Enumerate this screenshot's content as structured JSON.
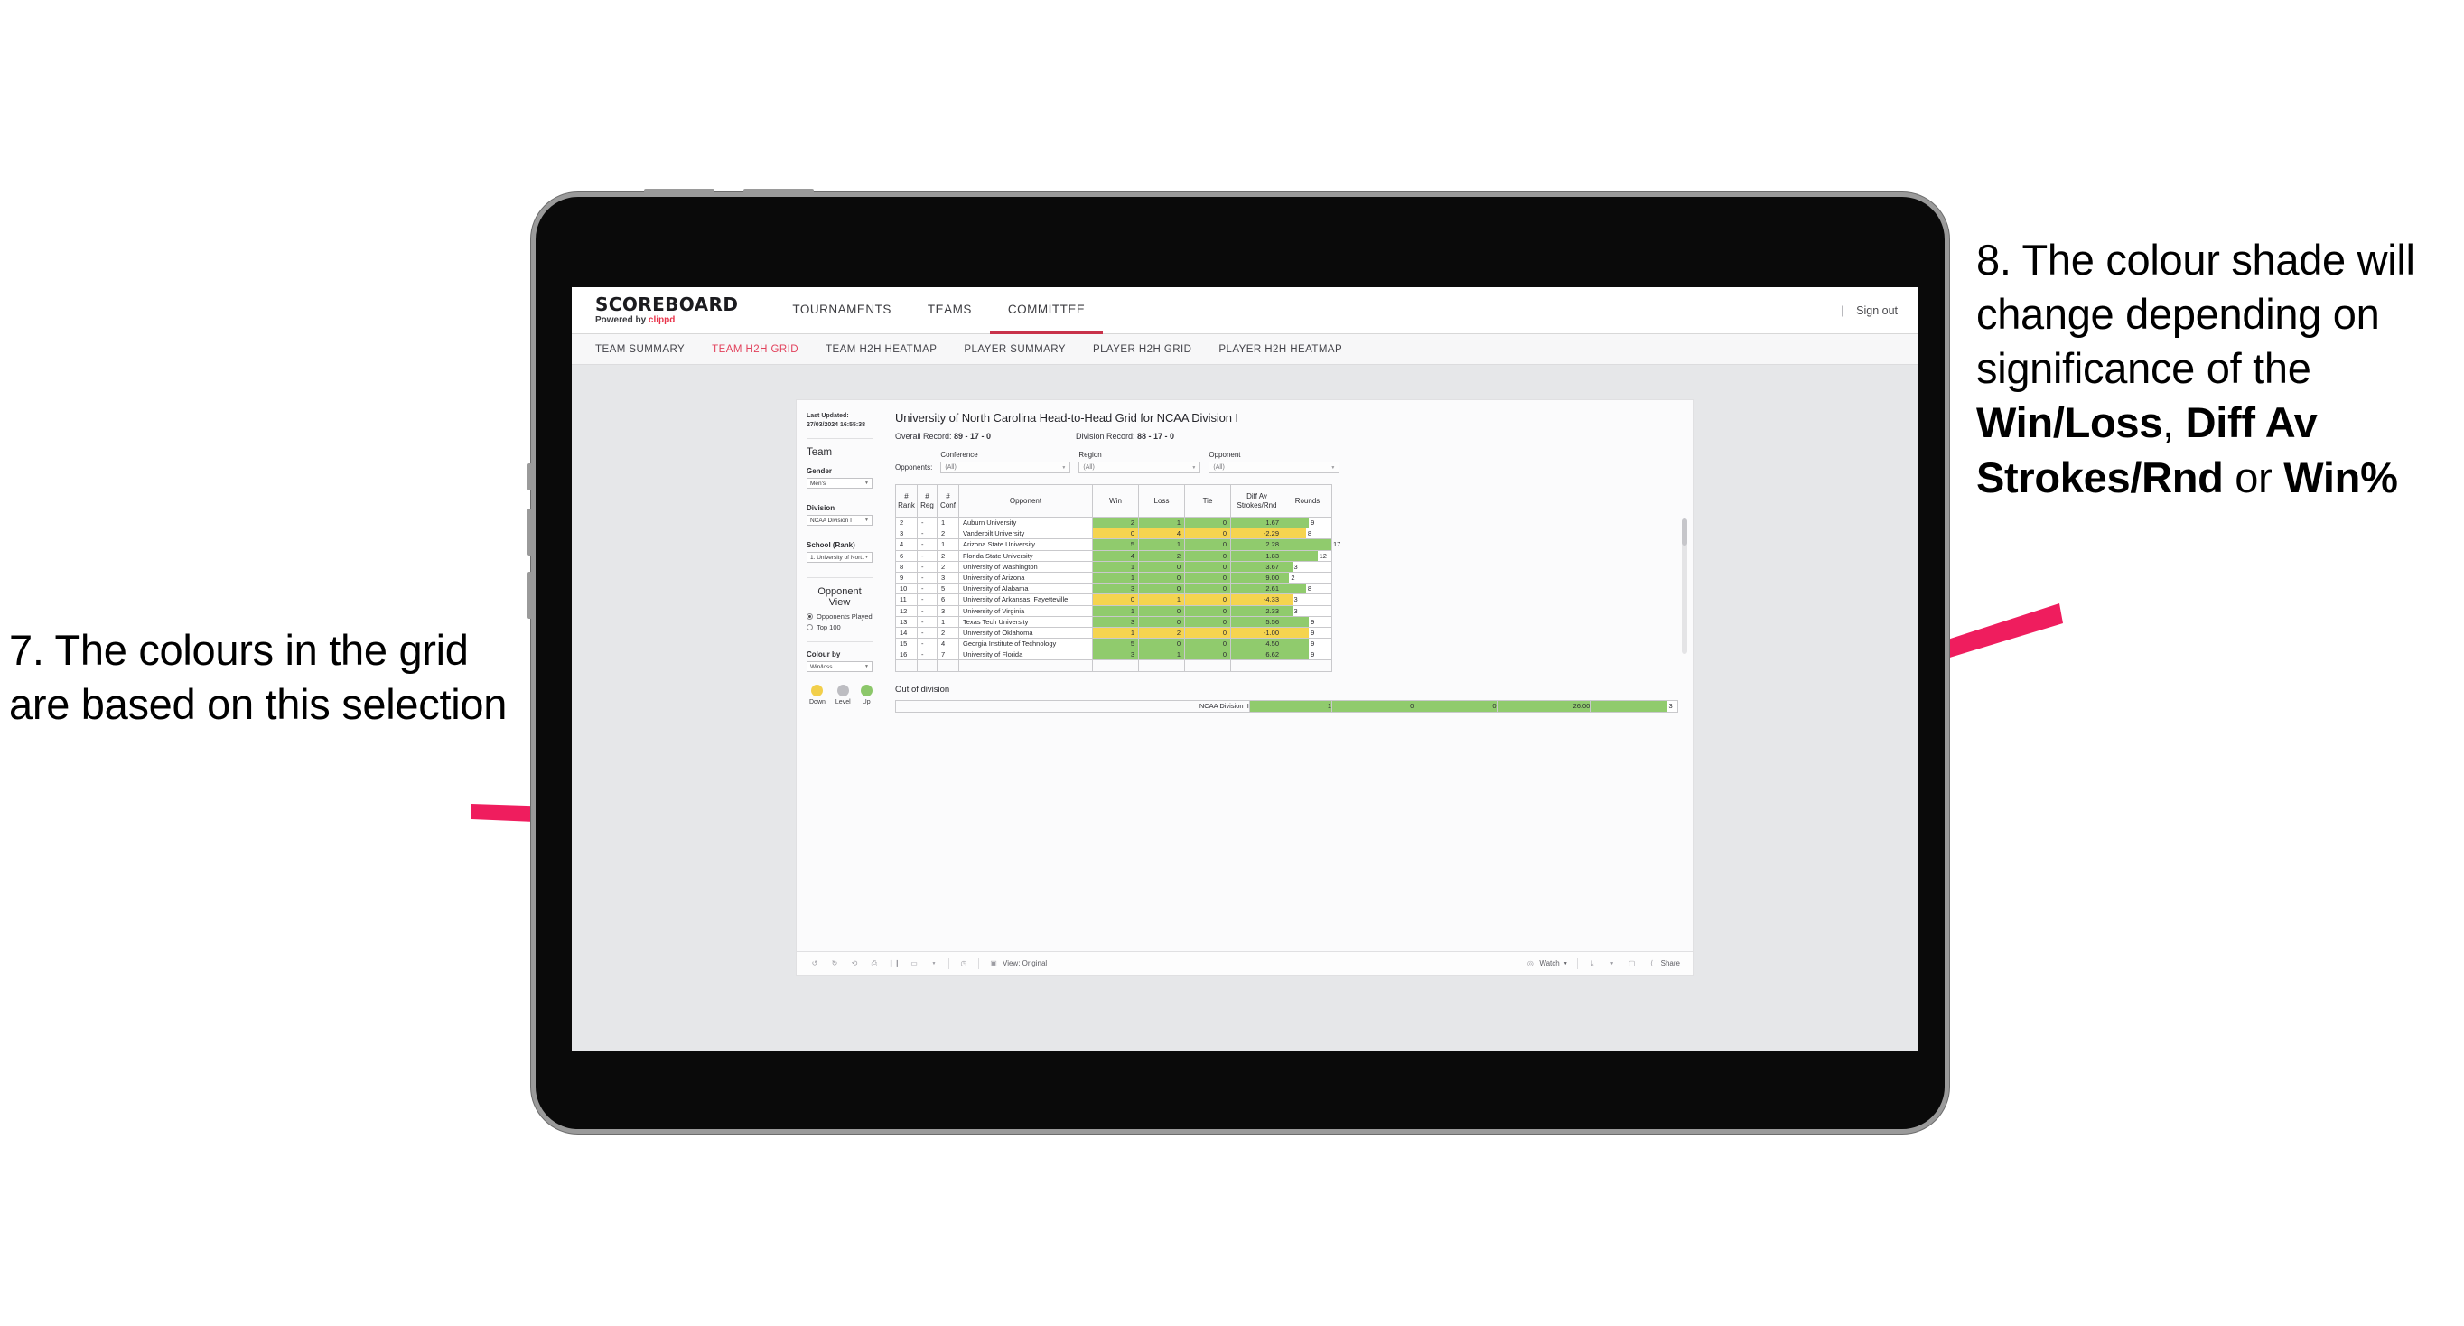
{
  "annotations": {
    "left": {
      "id": "7",
      "text": "7. The colours in the grid are based on this selection"
    },
    "right": {
      "id": "8",
      "prefix": "8. The colour shade will change depending on significance of the ",
      "bold1": "Win/Loss",
      "mid1": ", ",
      "bold2": "Diff Av Strokes/Rnd",
      "mid2": " or ",
      "bold3": "Win%"
    },
    "arrow_color": "#ef1d5e"
  },
  "app": {
    "logo": {
      "main": "SCOREBOARD",
      "sub_prefix": "Powered by ",
      "sub_brand": "clippd"
    },
    "nav": [
      {
        "label": "TOURNAMENTS",
        "active": false
      },
      {
        "label": "TEAMS",
        "active": false
      },
      {
        "label": "COMMITTEE",
        "active": true
      }
    ],
    "header_right": {
      "separator": "|",
      "signout": "Sign out"
    },
    "subtabs": [
      {
        "label": "TEAM SUMMARY",
        "active": false
      },
      {
        "label": "TEAM H2H GRID",
        "active": true
      },
      {
        "label": "TEAM H2H HEATMAP",
        "active": false
      },
      {
        "label": "PLAYER SUMMARY",
        "active": false
      },
      {
        "label": "PLAYER H2H GRID",
        "active": false
      },
      {
        "label": "PLAYER H2H HEATMAP",
        "active": false
      }
    ]
  },
  "sidebar": {
    "last_updated": "Last Updated: 27/03/2024 16:55:38",
    "team_title": "Team",
    "gender": {
      "label": "Gender",
      "value": "Men's"
    },
    "division": {
      "label": "Division",
      "value": "NCAA Division I"
    },
    "school": {
      "label": "School (Rank)",
      "value": "1. University of Nort..."
    },
    "opponent_view": {
      "title": "Opponent View",
      "options": [
        {
          "label": "Opponents Played",
          "selected": true
        },
        {
          "label": "Top 100",
          "selected": false
        }
      ]
    },
    "colour_by": {
      "label": "Colour by",
      "value": "Win/loss"
    },
    "legend": [
      {
        "label": "Down",
        "color": "#f2cf4b"
      },
      {
        "label": "Level",
        "color": "#bdbdc2"
      },
      {
        "label": "Up",
        "color": "#8cc76a"
      }
    ]
  },
  "main": {
    "title": "University of North Carolina Head-to-Head Grid for NCAA Division I",
    "overall_record_label": "Overall Record: ",
    "overall_record_value": "89 - 17 - 0",
    "division_record_label": "Division Record: ",
    "division_record_value": "88 - 17 - 0",
    "filters": {
      "lead": "Opponents:",
      "items": [
        {
          "label": "Conference",
          "value": "(All)"
        },
        {
          "label": "Region",
          "value": "(All)"
        },
        {
          "label": "Opponent",
          "value": "(All)"
        }
      ]
    },
    "table": {
      "headers": [
        "# Rank",
        "# Reg",
        "# Conf",
        "Opponent",
        "Win",
        "Loss",
        "Tie",
        "Diff Av Strokes/Rnd",
        "Rounds"
      ],
      "headers_split": [
        [
          "#",
          "Rank"
        ],
        [
          "#",
          "Reg"
        ],
        [
          "#",
          "Conf"
        ],
        [
          "",
          "Opponent"
        ],
        [
          "",
          "Win"
        ],
        [
          "",
          "Loss"
        ],
        [
          "",
          "Tie"
        ],
        [
          "Diff Av",
          "Strokes/Rnd"
        ],
        [
          "",
          "Rounds"
        ]
      ],
      "rows": [
        {
          "rank": "2",
          "reg": "-",
          "conf": "1",
          "opponent": "Auburn University",
          "win": "2",
          "loss": "1",
          "tie": "0",
          "diff": "1.67",
          "rounds": "9",
          "color": "green",
          "bar_pct": 53
        },
        {
          "rank": "3",
          "reg": "-",
          "conf": "2",
          "opponent": "Vanderbilt University",
          "win": "0",
          "loss": "4",
          "tie": "0",
          "diff": "-2.29",
          "rounds": "8",
          "color": "yellow",
          "bar_pct": 47
        },
        {
          "rank": "4",
          "reg": "-",
          "conf": "1",
          "opponent": "Arizona State University",
          "win": "5",
          "loss": "1",
          "tie": "0",
          "diff": "2.28",
          "rounds": "17",
          "color": "green",
          "bar_pct": 100
        },
        {
          "rank": "6",
          "reg": "-",
          "conf": "2",
          "opponent": "Florida State University",
          "win": "4",
          "loss": "2",
          "tie": "0",
          "diff": "1.83",
          "rounds": "12",
          "color": "green",
          "bar_pct": 71
        },
        {
          "rank": "8",
          "reg": "-",
          "conf": "2",
          "opponent": "University of Washington",
          "win": "1",
          "loss": "0",
          "tie": "0",
          "diff": "3.67",
          "rounds": "3",
          "color": "green",
          "bar_pct": 18
        },
        {
          "rank": "9",
          "reg": "-",
          "conf": "3",
          "opponent": "University of Arizona",
          "win": "1",
          "loss": "0",
          "tie": "0",
          "diff": "9.00",
          "rounds": "2",
          "color": "green",
          "bar_pct": 12
        },
        {
          "rank": "10",
          "reg": "-",
          "conf": "5",
          "opponent": "University of Alabama",
          "win": "3",
          "loss": "0",
          "tie": "0",
          "diff": "2.61",
          "rounds": "8",
          "color": "green",
          "bar_pct": 47
        },
        {
          "rank": "11",
          "reg": "-",
          "conf": "6",
          "opponent": "University of Arkansas, Fayetteville",
          "win": "0",
          "loss": "1",
          "tie": "0",
          "diff": "-4.33",
          "rounds": "3",
          "color": "yellow",
          "bar_pct": 18
        },
        {
          "rank": "12",
          "reg": "-",
          "conf": "3",
          "opponent": "University of Virginia",
          "win": "1",
          "loss": "0",
          "tie": "0",
          "diff": "2.33",
          "rounds": "3",
          "color": "green",
          "bar_pct": 18
        },
        {
          "rank": "13",
          "reg": "-",
          "conf": "1",
          "opponent": "Texas Tech University",
          "win": "3",
          "loss": "0",
          "tie": "0",
          "diff": "5.56",
          "rounds": "9",
          "color": "green",
          "bar_pct": 53
        },
        {
          "rank": "14",
          "reg": "-",
          "conf": "2",
          "opponent": "University of Oklahoma",
          "win": "1",
          "loss": "2",
          "tie": "0",
          "diff": "-1.00",
          "rounds": "9",
          "color": "yellow",
          "bar_pct": 53
        },
        {
          "rank": "15",
          "reg": "-",
          "conf": "4",
          "opponent": "Georgia Institute of Technology",
          "win": "5",
          "loss": "0",
          "tie": "0",
          "diff": "4.50",
          "rounds": "9",
          "color": "green",
          "bar_pct": 53
        },
        {
          "rank": "16",
          "reg": "-",
          "conf": "7",
          "opponent": "University of Florida",
          "win": "3",
          "loss": "1",
          "tie": "0",
          "diff": "6.62",
          "rounds": "9",
          "color": "green",
          "bar_pct": 53
        }
      ]
    },
    "out_of_division": {
      "title": "Out of division",
      "row": {
        "opponent": "NCAA Division II",
        "win": "1",
        "loss": "0",
        "tie": "0",
        "diff": "26.00",
        "rounds": "3",
        "color": "green",
        "bar_pct": 100
      }
    },
    "toolbar": {
      "icons": [
        "undo-icon",
        "redo-icon",
        "revert-icon",
        "refresh-icon",
        "pause-icon",
        "alerts-icon"
      ],
      "view_label": "View: Original",
      "watch_label": "Watch",
      "share_label": "Share"
    }
  }
}
